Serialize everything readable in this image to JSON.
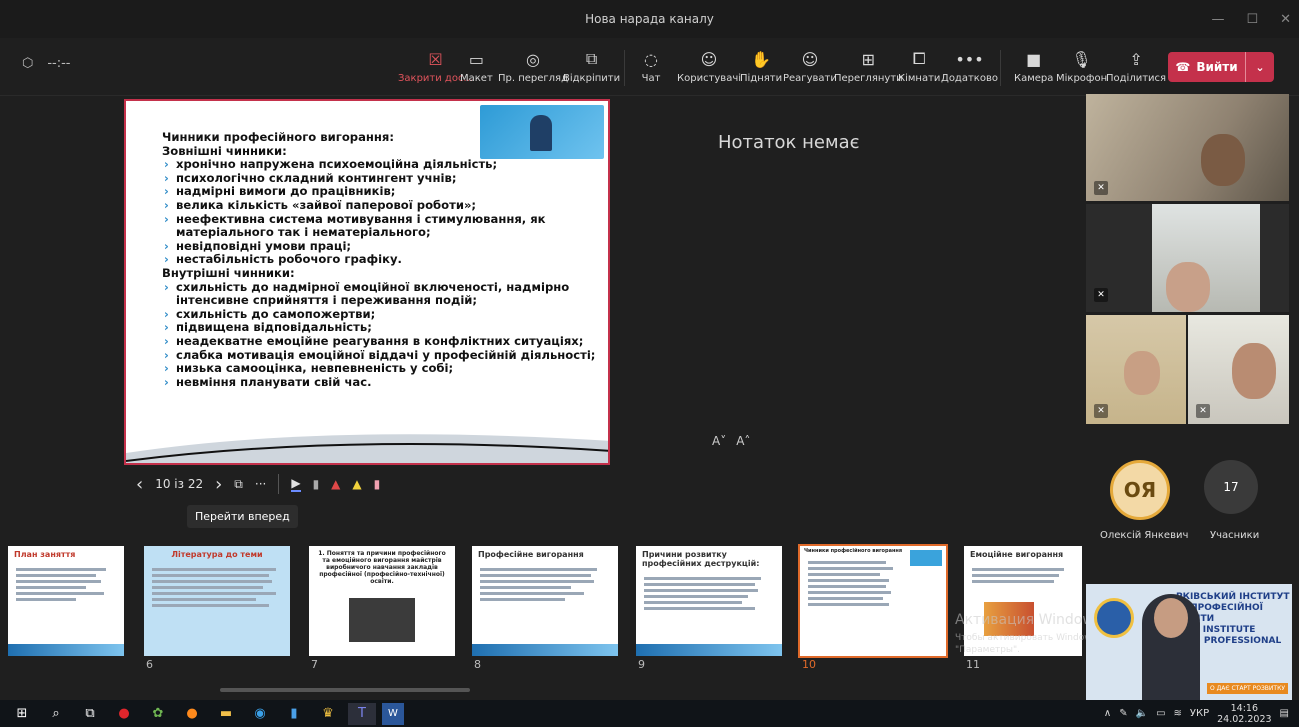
{
  "window": {
    "title": "Нова нарада каналу",
    "controls": [
      "—",
      "☐",
      "✕"
    ]
  },
  "toolbar": {
    "timer": "--:--",
    "buttons": [
      {
        "label": "Закрити дос...",
        "icon": "close-share-icon",
        "glyph": "☒"
      },
      {
        "label": "Макет",
        "icon": "layout-icon",
        "glyph": "▭"
      },
      {
        "label": "Пр. перегляд",
        "icon": "preview-icon",
        "glyph": "◎"
      },
      {
        "label": "Відкріпити",
        "icon": "popout-icon",
        "glyph": "⧉"
      },
      {
        "label": "Чат",
        "icon": "chat-icon",
        "glyph": "◌"
      },
      {
        "label": "Користувачі",
        "icon": "people-icon",
        "glyph": "☺"
      },
      {
        "label": "Підняти",
        "icon": "raise-hand-icon",
        "glyph": "✋"
      },
      {
        "label": "Реагувати",
        "icon": "react-icon",
        "glyph": "☺"
      },
      {
        "label": "Переглянути",
        "icon": "view-icon",
        "glyph": "⊞"
      },
      {
        "label": "Кімнати",
        "icon": "rooms-icon",
        "glyph": "⧠"
      },
      {
        "label": "Додатково",
        "icon": "more-icon",
        "glyph": "•••"
      },
      {
        "label": "Камера",
        "icon": "camera-icon",
        "glyph": "■"
      },
      {
        "label": "Мікрофон",
        "icon": "microphone-icon",
        "glyph": "🎙"
      },
      {
        "label": "Поділитися",
        "icon": "share-icon",
        "glyph": "⇪"
      }
    ],
    "leave_label": "Вийти"
  },
  "slide": {
    "lines": [
      {
        "kind": "h",
        "text": "Чинники професійного вигорання:"
      },
      {
        "kind": "h",
        "text": "Зовнішні чинники:"
      },
      {
        "kind": "li",
        "text": "хронічно напружена психоемоційна діяльність;"
      },
      {
        "kind": "li",
        "text": "психологічно складний контингент учнів;"
      },
      {
        "kind": "li",
        "text": "надмірні вимоги до працівників;"
      },
      {
        "kind": "li",
        "text": "велика кількість «зайвої паперової роботи»;"
      },
      {
        "kind": "li",
        "text": "неефективна система мотивування і стимулювання, як матеріального так і нематеріального;"
      },
      {
        "kind": "li",
        "text": "невідповідні умови праці;"
      },
      {
        "kind": "li",
        "text": "нестабільність робочого графіку."
      },
      {
        "kind": "h",
        "text": "Внутрішні чинники:"
      },
      {
        "kind": "li",
        "text": "схильність до надмірної емоційної включеності, надмірно інтенсивне сприйняття і переживання подій;"
      },
      {
        "kind": "li",
        "text": "схильність до самопожертви;"
      },
      {
        "kind": "li",
        "text": "підвищена відповідальність;"
      },
      {
        "kind": "li",
        "text": "неадекватне емоційне реагування в конфліктних ситуаціях;"
      },
      {
        "kind": "li",
        "text": "слабка мотивація емоційної віддачі у професійній діяльності;"
      },
      {
        "kind": "li",
        "text": "низька самооцінка, невпевненість у собі;"
      },
      {
        "kind": "li",
        "text": "невміння планувати свій час."
      }
    ]
  },
  "notes": {
    "empty_text": "Нотаток немає",
    "font_smaller": "A˅",
    "font_larger": "A˄"
  },
  "nav": {
    "page_indicator": "10 із 22",
    "tooltip": "Перейти вперед"
  },
  "participants": {
    "avatar_initials": "ОЯ",
    "avatar_name": "Олексій Янкевич",
    "count": "17",
    "count_label": "Учасники"
  },
  "thumbnails": [
    {
      "num": "",
      "title": "План заняття"
    },
    {
      "num": "6",
      "title": "Література до теми"
    },
    {
      "num": "7",
      "title": "1. Поняття та причини професійного та емоційного вигорання майстрів виробничого навчання закладів професійної (професійно-технічної) освіти."
    },
    {
      "num": "8",
      "title": "Професійне вигорання"
    },
    {
      "num": "9",
      "title": "Причини розвитку професійних деструкцій:"
    },
    {
      "num": "10",
      "title": "Чинники професійного вигорання"
    },
    {
      "num": "11",
      "title": "Емоційне вигорання"
    }
  ],
  "watermark": {
    "title": "Активация Windows",
    "line1": "Чтобы активировать Windows, перейдите в",
    "line2": "\"Параметры\"."
  },
  "presenter": {
    "banner1": "РКІВСЬКИЙ ІНСТИТУТ",
    "banner2": "ОЇ ПРОФЕСІЙНОЇ ОСВІТИ",
    "banner3": "KIVA INSTITUTE",
    "banner4": "IOUS PROFESSIONAL",
    "tag": "О ДАЄ СТАРТ РОЗВИТКУ"
  },
  "taskbar": {
    "lang": "УКР",
    "time": "14:16",
    "date": "24.02.2023"
  }
}
